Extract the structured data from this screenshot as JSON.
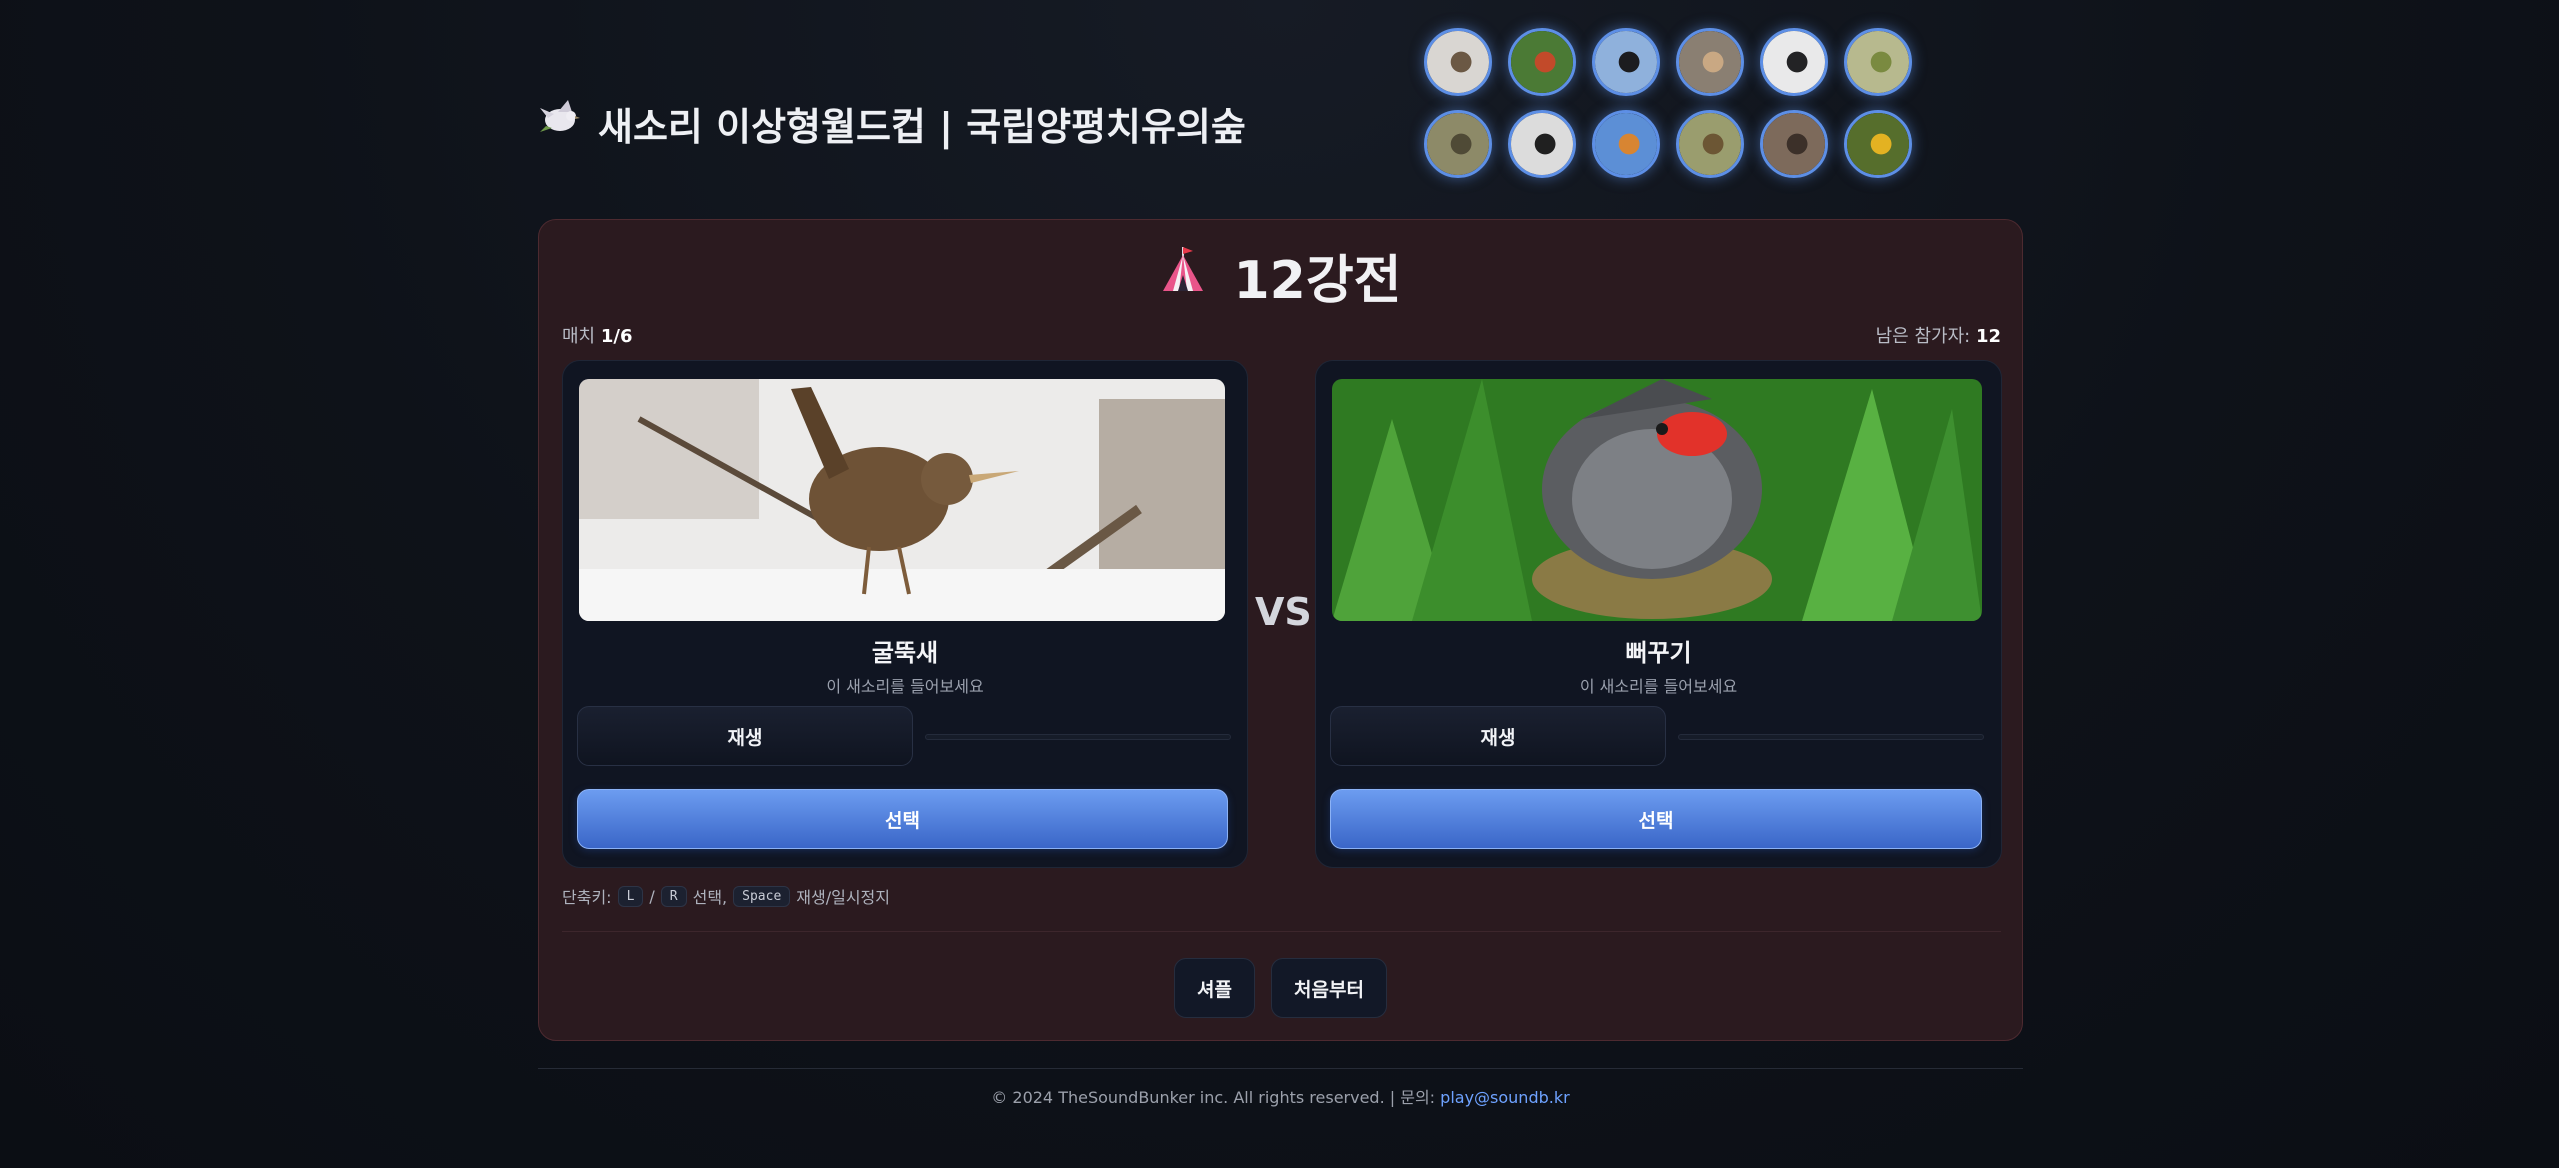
{
  "header": {
    "title": "새소리 이상형월드컵 | 국립양평치유의숲",
    "logo_icon": "dove-icon",
    "thumbnails": [
      {
        "icon": "wren-thumbnail",
        "color": "#d9d6d2",
        "accent": "#6b5844"
      },
      {
        "icon": "red-bird-thumbnail",
        "color": "#4b7a35",
        "accent": "#c24a2a"
      },
      {
        "icon": "black-bird-sky-thumbnail",
        "color": "#8fb1dc",
        "accent": "#1c1c1f"
      },
      {
        "icon": "grey-bird-thumbnail",
        "color": "#8a7f72",
        "accent": "#c9a883"
      },
      {
        "icon": "black-white-bird-thumbnail",
        "color": "#e9e9ea",
        "accent": "#232325"
      },
      {
        "icon": "branch-bird-thumbnail",
        "color": "#b7b98e",
        "accent": "#7a8a40"
      },
      {
        "icon": "nest-bird-thumbnail",
        "color": "#8d8a68",
        "accent": "#4f4a36"
      },
      {
        "icon": "magpie-thumbnail",
        "color": "#dcdcdc",
        "accent": "#202020"
      },
      {
        "icon": "orange-bird-sky-thumbnail",
        "color": "#5c8fd6",
        "accent": "#d88532"
      },
      {
        "icon": "tit-thumbnail",
        "color": "#9a9d6e",
        "accent": "#6c5634"
      },
      {
        "icon": "pebble-bird-thumbnail",
        "color": "#7d6a5b",
        "accent": "#3c3029"
      },
      {
        "icon": "oriole-thumbnail",
        "color": "#566e2c",
        "accent": "#e3b222"
      }
    ]
  },
  "round": {
    "icon": "tent-icon",
    "title": "12강전"
  },
  "meta": {
    "match_label": "매치",
    "match_value": "1/6",
    "remaining_label": "남은 참가자:",
    "remaining_value": "12"
  },
  "left_card": {
    "bird_name": "굴뚝새",
    "hint": "이 새소리를 들어보세요",
    "play_label": "재생",
    "select_label": "선택",
    "progress": 0,
    "photo_colors": {
      "bg": "#ecebea",
      "bird": "#6e5236"
    }
  },
  "vs_label": "VS",
  "right_card": {
    "bird_name": "뻐꾸기",
    "hint": "이 새소리를 들어보세요",
    "play_label": "재생",
    "select_label": "선택",
    "progress": 0,
    "photo_colors": {
      "bg": "#2f7a22",
      "bird": "#5b5d61",
      "mouth": "#e2322a"
    }
  },
  "shortcuts": {
    "label": "단축키:",
    "key_l": "L",
    "slash": "/",
    "key_r": "R",
    "select_text": "선택,",
    "key_space": "Space",
    "play_text": "재생/일시정지"
  },
  "buttons": {
    "shuffle": "셔플",
    "restart": "처음부터"
  },
  "footer": {
    "text": "© 2024 TheSoundBunker inc. All rights reserved. | 문의:",
    "email": "play@soundb.kr"
  },
  "colors": {
    "accent_blue": "#4d7fe0",
    "panel_bg": "#2b1a1f",
    "card_bg": "#101522"
  }
}
